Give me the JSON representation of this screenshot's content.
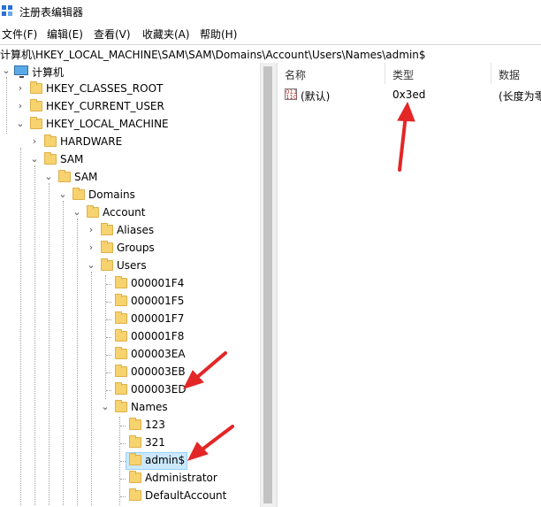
{
  "window": {
    "title": "注册表编辑器"
  },
  "menu": [
    "文件(F)",
    "编辑(E)",
    "查看(V)",
    "收藏夹(A)",
    "帮助(H)"
  ],
  "address": "计算机\\HKEY_LOCAL_MACHINE\\SAM\\SAM\\Domains\\Account\\Users\\Names\\admin$",
  "tree": [
    {
      "label": "计算机",
      "icon": "computer-icon",
      "expander": "expanded"
    },
    {
      "label": "HKEY_CLASSES_ROOT",
      "icon": "folder-icon",
      "expander": "collapsed"
    },
    {
      "label": "HKEY_CURRENT_USER",
      "icon": "folder-icon",
      "expander": "collapsed"
    },
    {
      "label": "HKEY_LOCAL_MACHINE",
      "icon": "folder-icon",
      "expander": "expanded"
    },
    {
      "label": "HARDWARE",
      "icon": "folder-icon",
      "expander": "collapsed"
    },
    {
      "label": "SAM",
      "icon": "folder-icon",
      "expander": "expanded"
    },
    {
      "label": "SAM",
      "icon": "folder-icon",
      "expander": "expanded"
    },
    {
      "label": "Domains",
      "icon": "folder-icon",
      "expander": "expanded"
    },
    {
      "label": "Account",
      "icon": "folder-icon",
      "expander": "expanded"
    },
    {
      "label": "Aliases",
      "icon": "folder-icon",
      "expander": "collapsed"
    },
    {
      "label": "Groups",
      "icon": "folder-icon",
      "expander": "collapsed"
    },
    {
      "label": "Users",
      "icon": "folder-icon",
      "expander": "expanded"
    },
    {
      "label": "000001F4",
      "icon": "folder-icon",
      "expander": "none"
    },
    {
      "label": "000001F5",
      "icon": "folder-icon",
      "expander": "none"
    },
    {
      "label": "000001F7",
      "icon": "folder-icon",
      "expander": "none"
    },
    {
      "label": "000001F8",
      "icon": "folder-icon",
      "expander": "none"
    },
    {
      "label": "000003EA",
      "icon": "folder-icon",
      "expander": "none"
    },
    {
      "label": "000003EB",
      "icon": "folder-icon",
      "expander": "none"
    },
    {
      "label": "000003ED",
      "icon": "folder-icon",
      "expander": "none"
    },
    {
      "label": "Names",
      "icon": "folder-icon",
      "expander": "expanded"
    },
    {
      "label": "123",
      "icon": "folder-icon",
      "expander": "none"
    },
    {
      "label": "321",
      "icon": "folder-icon",
      "expander": "none"
    },
    {
      "label": "admin$",
      "icon": "folder-icon",
      "expander": "none",
      "selected": true
    },
    {
      "label": "Administrator",
      "icon": "folder-icon",
      "expander": "none"
    },
    {
      "label": "DefaultAccount",
      "icon": "folder-icon",
      "expander": "none"
    }
  ],
  "list": {
    "headers": [
      "名称",
      "类型",
      "数据"
    ],
    "rows": [
      {
        "name": "(默认)",
        "type": "0x3ed",
        "data": "(长度为零"
      }
    ]
  },
  "colors": {
    "selection": "#cce8ff",
    "folder": "#f7d36f",
    "annotation_arrow": "#e32626"
  }
}
